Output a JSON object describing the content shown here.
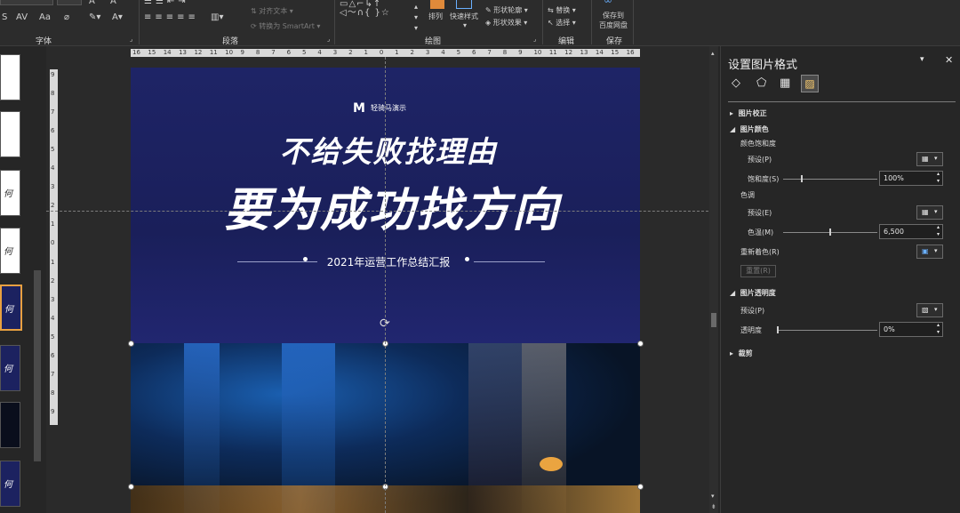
{
  "ribbon": {
    "groups": {
      "font": "字体",
      "paragraph": "段落",
      "drawing": "绘图",
      "editing": "编辑",
      "save": "保存"
    },
    "paragraph": {
      "align_text": "对齐文本",
      "convert_smartart": "转换为 SmartArt"
    },
    "drawing": {
      "arrange": "排列",
      "quick_styles": "快速样式",
      "shape_outline": "形状轮廓",
      "shape_effects": "形状效果"
    },
    "editing": {
      "replace": "替换",
      "select": "选择"
    },
    "save": {
      "save_to_baidu": "保存到",
      "save_to_baidu_2": "百度网盘"
    }
  },
  "thumbnail_labels": [
    "何",
    "何",
    "何",
    "何",
    "何"
  ],
  "slide": {
    "logo_text": "轻骑马演示",
    "headline1": "不给失败找理由",
    "headline2": "要为成功找方向",
    "subtitle": "2021年运营工作总结汇报"
  },
  "panel": {
    "title": "设置图片格式",
    "sections": {
      "correction": "图片校正",
      "color": "图片颜色",
      "transparency": "图片透明度",
      "crop": "裁剪"
    },
    "color": {
      "saturation_header": "颜色饱和度",
      "preset_label": "预设(P)",
      "saturation_label": "饱和度(S)",
      "saturation_value": "100%",
      "saturation_level": 0.2,
      "tone_header": "色调",
      "tone_preset_label": "预设(E)",
      "temperature_label": "色温(M)",
      "temperature_value": "6,500",
      "temperature_level": 0.5,
      "recolor_label": "重新着色(R)",
      "reset_label": "重置(R)"
    },
    "transparency": {
      "preset_label": "预设(P)",
      "transparency_label": "透明度",
      "transparency_value": "0%",
      "transparency_level": 0
    }
  },
  "ruler": {
    "h_ticks": [
      "16",
      "15",
      "14",
      "13",
      "12",
      "11",
      "10",
      "9",
      "8",
      "7",
      "6",
      "5",
      "4",
      "3",
      "2",
      "1",
      "0",
      "1",
      "2",
      "3",
      "4",
      "5",
      "6",
      "7",
      "8",
      "9",
      "10",
      "11",
      "12",
      "13",
      "14",
      "15",
      "16"
    ],
    "v_ticks": [
      "9",
      "8",
      "7",
      "6",
      "5",
      "4",
      "3",
      "2",
      "1",
      "0",
      "1",
      "2",
      "3",
      "4",
      "5",
      "6",
      "7",
      "8",
      "9"
    ]
  },
  "colors": {
    "accent": "#e8a040",
    "slide_bg": "#1e2466"
  }
}
